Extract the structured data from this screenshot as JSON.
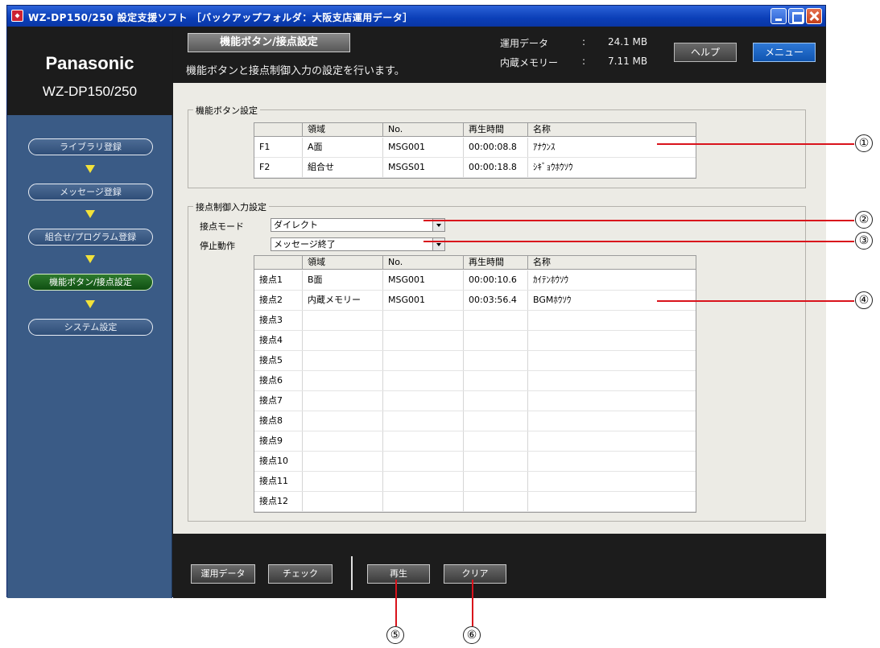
{
  "window": {
    "title": "WZ-DP150/250 設定支援ソフト ［バックアップフォルダ：大阪支店運用データ］"
  },
  "sidebar": {
    "brand": "Panasonic",
    "model": "WZ-DP150/250",
    "items": [
      {
        "label": "ライブラリ登録",
        "active": false
      },
      {
        "label": "メッセージ登録",
        "active": false
      },
      {
        "label": "組合せ/プログラム登録",
        "active": false
      },
      {
        "label": "機能ボタン/接点設定",
        "active": true
      },
      {
        "label": "システム設定",
        "active": false
      }
    ]
  },
  "header": {
    "page_title": "機能ボタン/接点設定",
    "description": "機能ボタンと接点制御入力の設定を行います。",
    "stats": [
      {
        "label": "運用データ",
        "colon": ":",
        "value": "24.1 MB"
      },
      {
        "label": "内蔵メモリー",
        "colon": ":",
        "value": "7.11 MB"
      }
    ],
    "help_label": "ヘルプ",
    "menu_label": "メニュー"
  },
  "function_buttons": {
    "group_title": "機能ボタン設定",
    "columns": [
      "",
      "領域",
      "No.",
      "再生時間",
      "名称"
    ],
    "rows": [
      [
        "F1",
        "A面",
        "MSG001",
        "00:00:08.8",
        "ｱﾅｳﾝｽ"
      ],
      [
        "F2",
        "組合せ",
        "MSGS01",
        "00:00:18.8",
        "ｼｷﾞｮｳﾎｳｿｳ"
      ]
    ]
  },
  "contact_input": {
    "group_title": "接点制御入力設定",
    "mode_label": "接点モード",
    "mode_value": "ダイレクト",
    "stop_label": "停止動作",
    "stop_value": "メッセージ終了",
    "columns": [
      "",
      "領域",
      "No.",
      "再生時間",
      "名称"
    ],
    "rows": [
      [
        "接点1",
        "B面",
        "MSG001",
        "00:00:10.6",
        "ｶｲﾃﾝﾎｳｿｳ"
      ],
      [
        "接点2",
        "内蔵メモリー",
        "MSG001",
        "00:03:56.4",
        "BGMﾎｳｿｳ"
      ],
      [
        "接点3",
        "",
        "",
        "",
        ""
      ],
      [
        "接点4",
        "",
        "",
        "",
        ""
      ],
      [
        "接点5",
        "",
        "",
        "",
        ""
      ],
      [
        "接点6",
        "",
        "",
        "",
        ""
      ],
      [
        "接点7",
        "",
        "",
        "",
        ""
      ],
      [
        "接点8",
        "",
        "",
        "",
        ""
      ],
      [
        "接点9",
        "",
        "",
        "",
        ""
      ],
      [
        "接点10",
        "",
        "",
        "",
        ""
      ],
      [
        "接点11",
        "",
        "",
        "",
        ""
      ],
      [
        "接点12",
        "",
        "",
        "",
        ""
      ]
    ]
  },
  "footer": {
    "buttons": [
      "運用データ",
      "チェック",
      "再生",
      "クリア"
    ]
  },
  "callouts": [
    "①",
    "②",
    "③",
    "④",
    "⑤",
    "⑥"
  ],
  "colors": {
    "titlebar": "#0b3fb8",
    "sidebar": "#3a5b86",
    "active_nav": "#1f6a22",
    "callout_line": "#d9131c",
    "menu_button": "#1a63c4"
  }
}
